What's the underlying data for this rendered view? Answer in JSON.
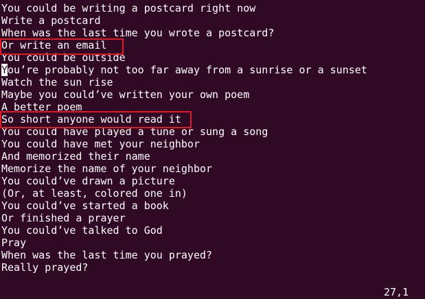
{
  "terminal": {
    "lines": [
      "You could be writing a postcard right now",
      "Write a postcard",
      "When was the last time you wrote a postcard?",
      "Or write an email",
      "You could be outside",
      "You’re probably not too far away from a sunrise or a sunset",
      "Watch the sun rise",
      "Maybe you could’ve written your own poem",
      "A better poem",
      "So short anyone would read it",
      "You could have played a tune or sung a song",
      "You could have met your neighbor",
      "And memorized their name",
      "Memorize the name of your neighbor",
      "You could’ve drawn a picture",
      "(Or, at least, colored one in)",
      "You could’ve started a book",
      "Or finished a prayer",
      "You could’ve talked to God",
      "Pray",
      "When was the last time you prayed?",
      "Really prayed?"
    ],
    "cursor_line_char": "Y",
    "cursor_line_rest": "ou’re probably not too far away from a sunrise or a sunset",
    "cursor_position": "27,1"
  },
  "colors": {
    "background": "#300a24",
    "text": "#ffffff",
    "highlight_border": "#e01b24"
  }
}
